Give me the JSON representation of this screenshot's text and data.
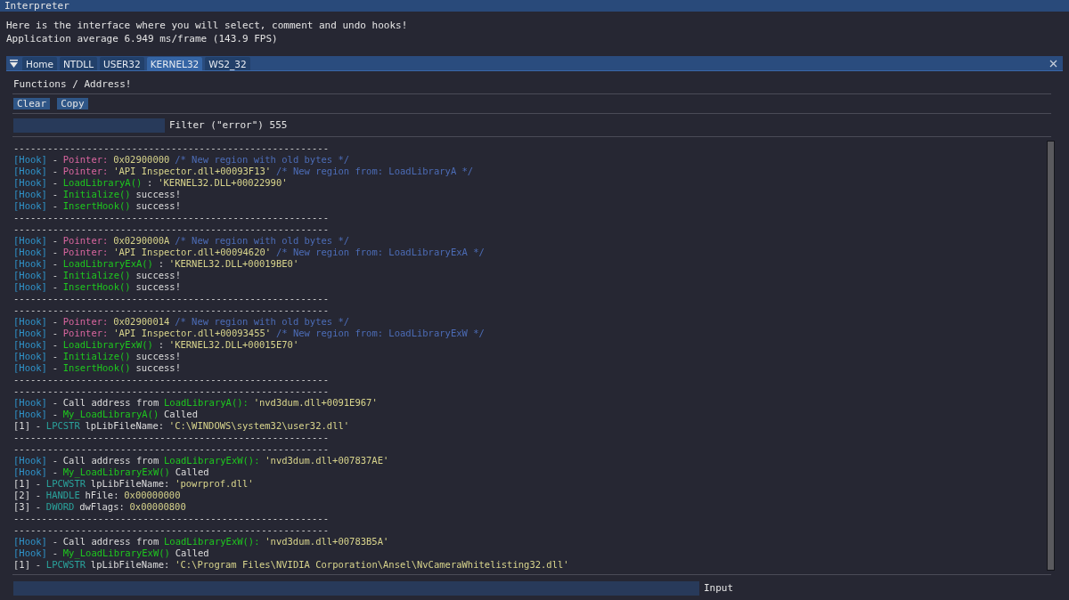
{
  "window": {
    "title": "Interpreter"
  },
  "intro": [
    "Here is the interface where you will select, comment and undo hooks!",
    "Application average 6.949 ms/frame (143.9 FPS)"
  ],
  "tabs": [
    {
      "label": "Home",
      "selected": false
    },
    {
      "label": "NTDLL",
      "selected": false
    },
    {
      "label": "USER32",
      "selected": false
    },
    {
      "label": "KERNEL32",
      "selected": true
    },
    {
      "label": "WS2_32",
      "selected": false
    }
  ],
  "section_title": "Functions / Address!",
  "buttons": [
    "Clear",
    "Copy"
  ],
  "filter": {
    "label": "Filter (\"error\") 555"
  },
  "log": [
    [
      {
        "kind": "plain",
        "text": "--------------------------------------------------------"
      }
    ],
    [
      {
        "kind": "tag",
        "text": "[Hook]"
      },
      {
        "kind": "plain",
        "text": "-"
      },
      {
        "kind": "label",
        "text": "Pointer:"
      },
      {
        "kind": "value",
        "text": "0x02900000"
      },
      {
        "kind": "comment",
        "text": "/* New region with old bytes */"
      }
    ],
    [
      {
        "kind": "tag",
        "text": "[Hook]"
      },
      {
        "kind": "plain",
        "text": "-"
      },
      {
        "kind": "label",
        "text": "Pointer:"
      },
      {
        "kind": "value",
        "text": "'API Inspector.dll+00093F13'"
      },
      {
        "kind": "comment",
        "text": "/* New region from: LoadLibraryA */"
      }
    ],
    [
      {
        "kind": "tag",
        "text": "[Hook]"
      },
      {
        "kind": "plain",
        "text": "-"
      },
      {
        "kind": "func",
        "text": "LoadLibraryA()"
      },
      {
        "kind": "plain",
        "text": ":"
      },
      {
        "kind": "value",
        "text": "'KERNEL32.DLL+00022990'"
      }
    ],
    [
      {
        "kind": "tag",
        "text": "[Hook]"
      },
      {
        "kind": "plain",
        "text": "-"
      },
      {
        "kind": "func",
        "text": "Initialize()"
      },
      {
        "kind": "plain",
        "text": "success!"
      }
    ],
    [
      {
        "kind": "tag",
        "text": "[Hook]"
      },
      {
        "kind": "plain",
        "text": "-"
      },
      {
        "kind": "func",
        "text": "InsertHook()"
      },
      {
        "kind": "plain",
        "text": "success!"
      }
    ],
    [
      {
        "kind": "plain",
        "text": "--------------------------------------------------------"
      }
    ],
    [
      {
        "kind": "plain",
        "text": "--------------------------------------------------------"
      }
    ],
    [
      {
        "kind": "tag",
        "text": "[Hook]"
      },
      {
        "kind": "plain",
        "text": "-"
      },
      {
        "kind": "label",
        "text": "Pointer:"
      },
      {
        "kind": "value",
        "text": "0x0290000A"
      },
      {
        "kind": "comment",
        "text": "/* New region with old bytes */"
      }
    ],
    [
      {
        "kind": "tag",
        "text": "[Hook]"
      },
      {
        "kind": "plain",
        "text": "-"
      },
      {
        "kind": "label",
        "text": "Pointer:"
      },
      {
        "kind": "value",
        "text": "'API Inspector.dll+00094620'"
      },
      {
        "kind": "comment",
        "text": "/* New region from: LoadLibraryExA */"
      }
    ],
    [
      {
        "kind": "tag",
        "text": "[Hook]"
      },
      {
        "kind": "plain",
        "text": "-"
      },
      {
        "kind": "func",
        "text": "LoadLibraryExA()"
      },
      {
        "kind": "plain",
        "text": ":"
      },
      {
        "kind": "value",
        "text": "'KERNEL32.DLL+00019BE0'"
      }
    ],
    [
      {
        "kind": "tag",
        "text": "[Hook]"
      },
      {
        "kind": "plain",
        "text": "-"
      },
      {
        "kind": "func",
        "text": "Initialize()"
      },
      {
        "kind": "plain",
        "text": "success!"
      }
    ],
    [
      {
        "kind": "tag",
        "text": "[Hook]"
      },
      {
        "kind": "plain",
        "text": "-"
      },
      {
        "kind": "func",
        "text": "InsertHook()"
      },
      {
        "kind": "plain",
        "text": "success!"
      }
    ],
    [
      {
        "kind": "plain",
        "text": "--------------------------------------------------------"
      }
    ],
    [
      {
        "kind": "plain",
        "text": "--------------------------------------------------------"
      }
    ],
    [
      {
        "kind": "tag",
        "text": "[Hook]"
      },
      {
        "kind": "plain",
        "text": "-"
      },
      {
        "kind": "label",
        "text": "Pointer:"
      },
      {
        "kind": "value",
        "text": "0x02900014"
      },
      {
        "kind": "comment",
        "text": "/* New region with old bytes */"
      }
    ],
    [
      {
        "kind": "tag",
        "text": "[Hook]"
      },
      {
        "kind": "plain",
        "text": "-"
      },
      {
        "kind": "label",
        "text": "Pointer:"
      },
      {
        "kind": "value",
        "text": "'API Inspector.dll+00093455'"
      },
      {
        "kind": "comment",
        "text": "/* New region from: LoadLibraryExW */"
      }
    ],
    [
      {
        "kind": "tag",
        "text": "[Hook]"
      },
      {
        "kind": "plain",
        "text": "-"
      },
      {
        "kind": "func",
        "text": "LoadLibraryExW()"
      },
      {
        "kind": "plain",
        "text": ":"
      },
      {
        "kind": "value",
        "text": "'KERNEL32.DLL+00015E70'"
      }
    ],
    [
      {
        "kind": "tag",
        "text": "[Hook]"
      },
      {
        "kind": "plain",
        "text": "-"
      },
      {
        "kind": "func",
        "text": "Initialize()"
      },
      {
        "kind": "plain",
        "text": "success!"
      }
    ],
    [
      {
        "kind": "tag",
        "text": "[Hook]"
      },
      {
        "kind": "plain",
        "text": "-"
      },
      {
        "kind": "func",
        "text": "InsertHook()"
      },
      {
        "kind": "plain",
        "text": "success!"
      }
    ],
    [
      {
        "kind": "plain",
        "text": "--------------------------------------------------------"
      }
    ],
    [
      {
        "kind": "plain",
        "text": "--------------------------------------------------------"
      }
    ],
    [
      {
        "kind": "tag",
        "text": "[Hook]"
      },
      {
        "kind": "plain",
        "text": "-"
      },
      {
        "kind": "plain",
        "text": "Call address from"
      },
      {
        "kind": "func",
        "text": "LoadLibraryA():"
      },
      {
        "kind": "value",
        "text": "'nvd3dum.dll+0091E967'"
      }
    ],
    [
      {
        "kind": "tag",
        "text": "[Hook]"
      },
      {
        "kind": "plain",
        "text": "-"
      },
      {
        "kind": "func",
        "text": "My_LoadLibraryA()"
      },
      {
        "kind": "plain",
        "text": "Called"
      }
    ],
    [
      {
        "kind": "plain",
        "text": "[1]"
      },
      {
        "kind": "plain",
        "text": "-"
      },
      {
        "kind": "type",
        "text": "LPCSTR"
      },
      {
        "kind": "plain",
        "text": "lpLibFileName:"
      },
      {
        "kind": "value",
        "text": "'C:\\WINDOWS\\system32\\user32.dll'"
      }
    ],
    [
      {
        "kind": "plain",
        "text": "--------------------------------------------------------"
      }
    ],
    [
      {
        "kind": "plain",
        "text": "--------------------------------------------------------"
      }
    ],
    [
      {
        "kind": "tag",
        "text": "[Hook]"
      },
      {
        "kind": "plain",
        "text": "-"
      },
      {
        "kind": "plain",
        "text": "Call address from"
      },
      {
        "kind": "func",
        "text": "LoadLibraryExW():"
      },
      {
        "kind": "value",
        "text": "'nvd3dum.dll+007837AE'"
      }
    ],
    [
      {
        "kind": "tag",
        "text": "[Hook]"
      },
      {
        "kind": "plain",
        "text": "-"
      },
      {
        "kind": "func",
        "text": "My_LoadLibraryExW()"
      },
      {
        "kind": "plain",
        "text": "Called"
      }
    ],
    [
      {
        "kind": "plain",
        "text": "[1]"
      },
      {
        "kind": "plain",
        "text": "-"
      },
      {
        "kind": "type",
        "text": "LPCWSTR"
      },
      {
        "kind": "plain",
        "text": "lpLibFileName:"
      },
      {
        "kind": "value",
        "text": "'powrprof.dll'"
      }
    ],
    [
      {
        "kind": "plain",
        "text": "[2]"
      },
      {
        "kind": "plain",
        "text": "-"
      },
      {
        "kind": "type",
        "text": "HANDLE"
      },
      {
        "kind": "plain",
        "text": "hFile:"
      },
      {
        "kind": "value",
        "text": "0x00000000"
      }
    ],
    [
      {
        "kind": "plain",
        "text": "[3]"
      },
      {
        "kind": "plain",
        "text": "-"
      },
      {
        "kind": "type",
        "text": "DWORD"
      },
      {
        "kind": "plain",
        "text": "dwFlags:"
      },
      {
        "kind": "value",
        "text": "0x00000800"
      }
    ],
    [
      {
        "kind": "plain",
        "text": "--------------------------------------------------------"
      }
    ],
    [
      {
        "kind": "plain",
        "text": "--------------------------------------------------------"
      }
    ],
    [
      {
        "kind": "tag",
        "text": "[Hook]"
      },
      {
        "kind": "plain",
        "text": "-"
      },
      {
        "kind": "plain",
        "text": "Call address from"
      },
      {
        "kind": "func",
        "text": "LoadLibraryExW():"
      },
      {
        "kind": "value",
        "text": "'nvd3dum.dll+00783B5A'"
      }
    ],
    [
      {
        "kind": "tag",
        "text": "[Hook]"
      },
      {
        "kind": "plain",
        "text": "-"
      },
      {
        "kind": "func",
        "text": "My_LoadLibraryExW()"
      },
      {
        "kind": "plain",
        "text": "Called"
      }
    ],
    [
      {
        "kind": "plain",
        "text": "[1]"
      },
      {
        "kind": "plain",
        "text": "-"
      },
      {
        "kind": "type",
        "text": "LPCWSTR"
      },
      {
        "kind": "plain",
        "text": "lpLibFileName:"
      },
      {
        "kind": "value",
        "text": "'C:\\Program Files\\NVIDIA Corporation\\Ansel\\NvCameraWhitelisting32.dll'"
      }
    ]
  ],
  "input": {
    "label": "Input"
  }
}
